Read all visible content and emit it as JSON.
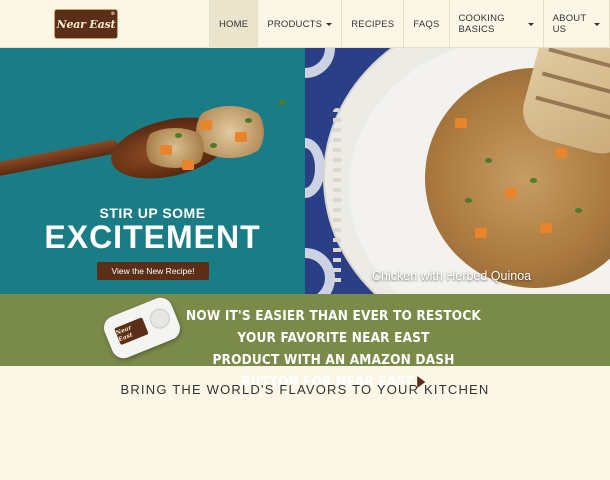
{
  "brand": {
    "logo_text": "Near East",
    "reg_mark": "®"
  },
  "nav": {
    "items": [
      {
        "label": "HOME",
        "has_dropdown": false,
        "active": true
      },
      {
        "label": "PRODUCTS",
        "has_dropdown": true,
        "active": false
      },
      {
        "label": "RECIPES",
        "has_dropdown": false,
        "active": false
      },
      {
        "label": "FAQS",
        "has_dropdown": false,
        "active": false
      },
      {
        "label": "COOKING BASICS",
        "has_dropdown": true,
        "active": false
      },
      {
        "label": "ABOUT US",
        "has_dropdown": true,
        "active": false
      }
    ]
  },
  "hero_left": {
    "headline_small": "STIR UP SOME",
    "headline_large": "EXCITEMENT",
    "cta_label": "View the New Recipe!",
    "background_color": "#1a7d86"
  },
  "hero_right": {
    "caption": "Chicken with Herbed Quinoa",
    "background_color": "#2b3f86"
  },
  "dash_banner": {
    "line1": "NOW IT'S EASIER THAN EVER TO RESTOCK YOUR FAVORITE NEAR EAST",
    "line2": "PRODUCT WITH AN AMAZON DASH BUTTON FOR NEAR EAST",
    "device_logo_text": "Near East",
    "arrow_icon": "play-arrow-icon",
    "background_color": "#7a8a49"
  },
  "tagline": "BRING THE WORLD'S FLAVORS TO YOUR KITCHEN",
  "colors": {
    "brand_brown": "#5a2e17",
    "page_bg": "#fbf6e6"
  }
}
